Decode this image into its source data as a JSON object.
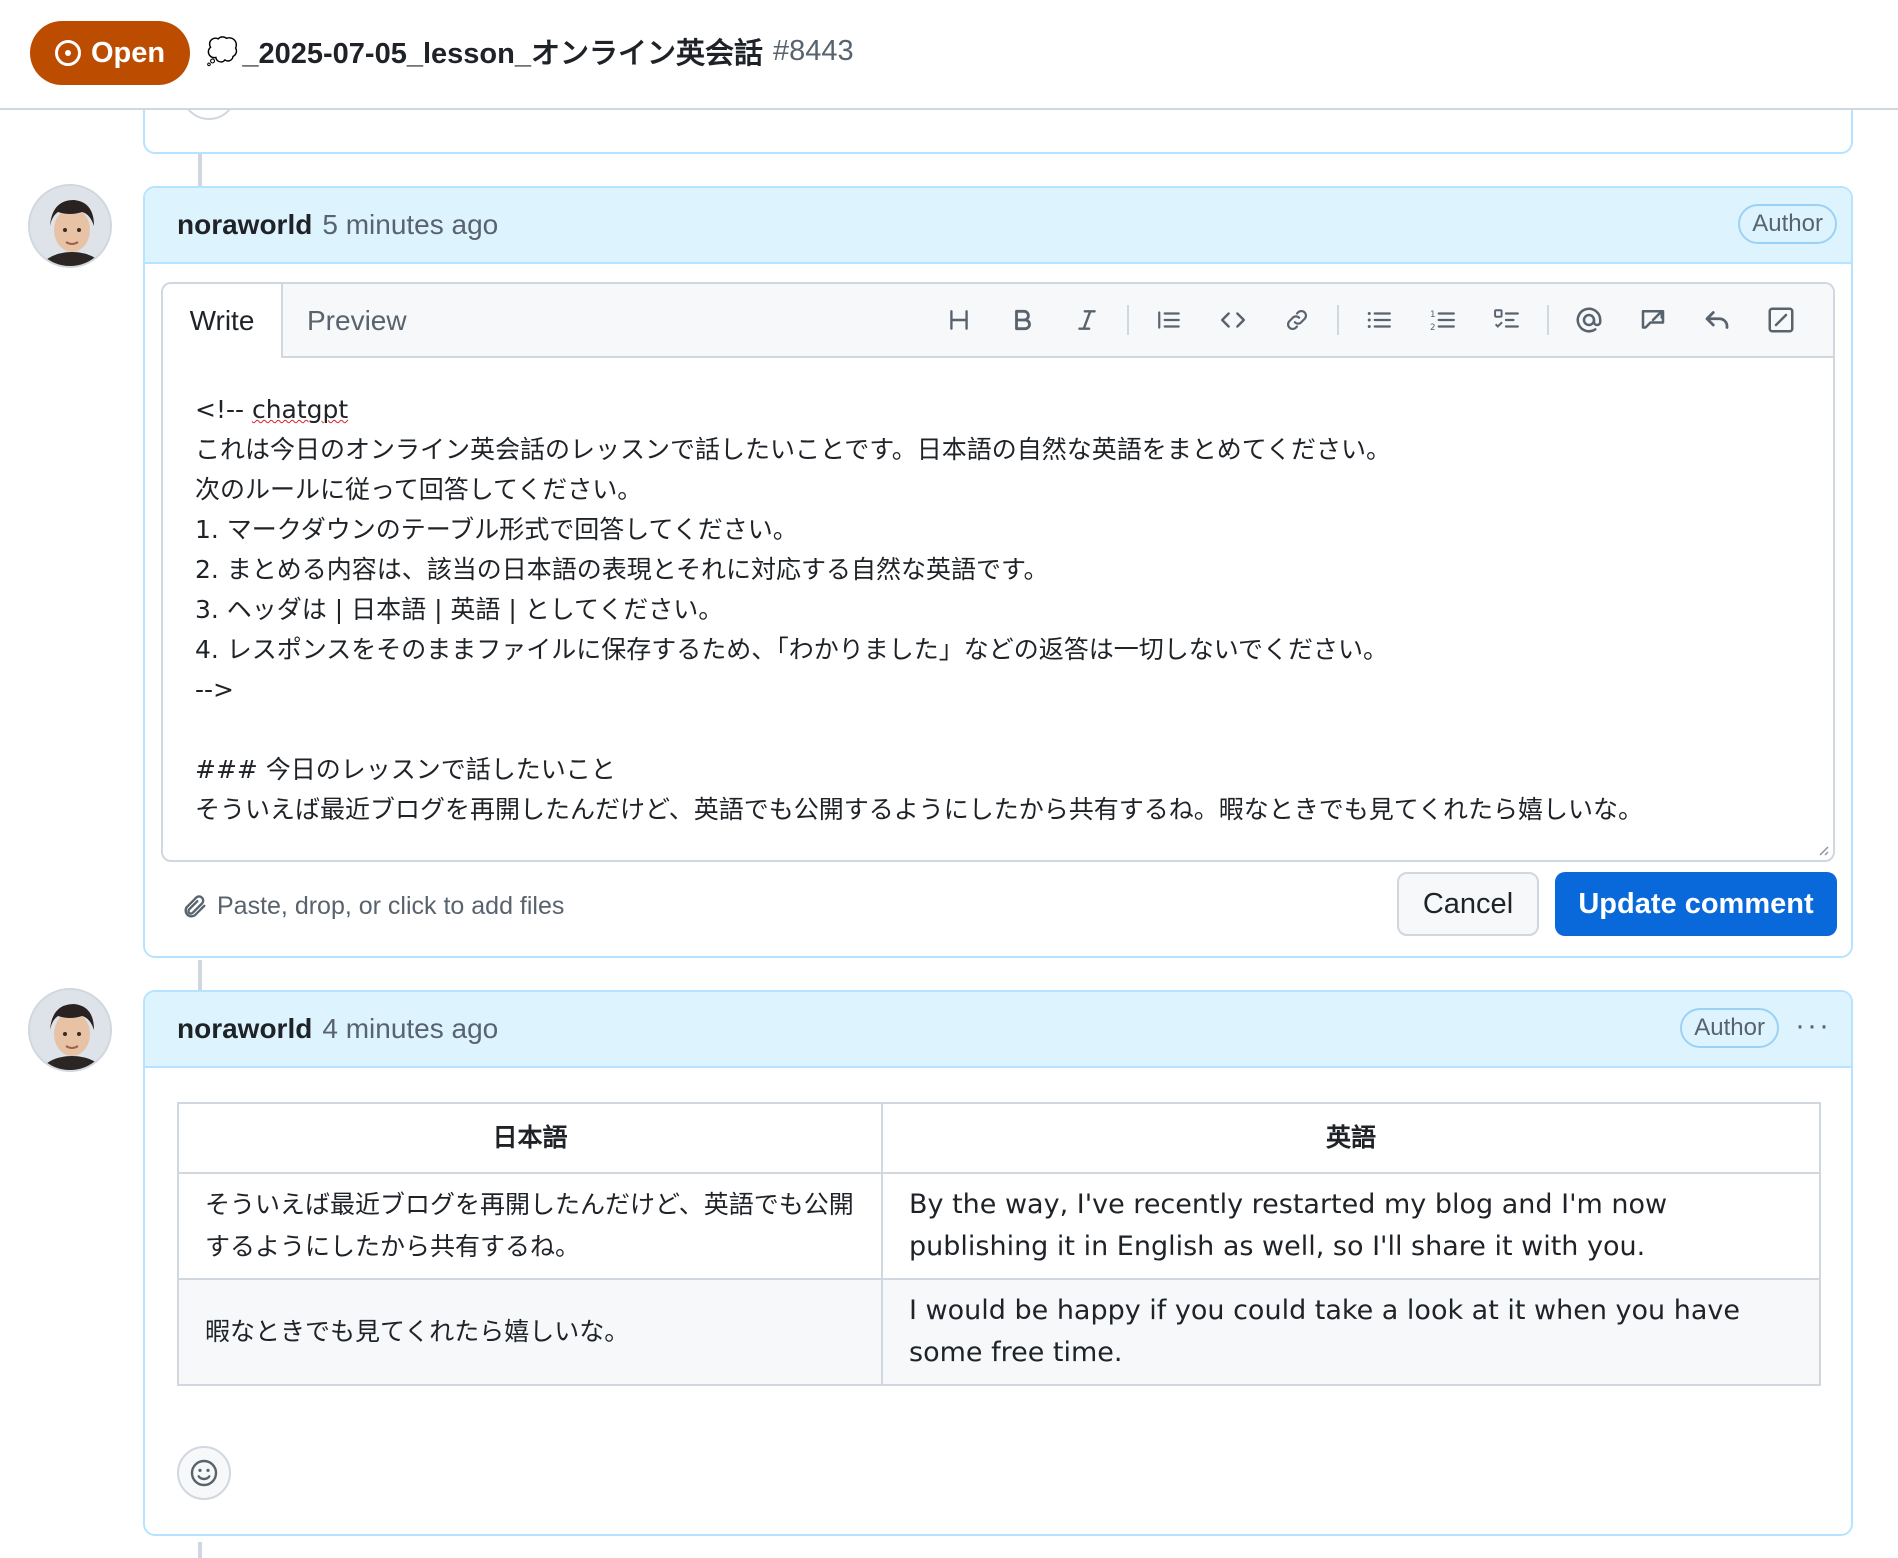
{
  "header": {
    "state_label": "Open",
    "title_icon": "speech-bubble-icon",
    "title": "_2025-07-05_lesson_オンライン英会話",
    "issue_number": "#8443"
  },
  "comment_edit": {
    "author": "noraworld",
    "time": "5 minutes ago",
    "badge": "Author",
    "tabs": {
      "write": "Write",
      "preview": "Preview"
    },
    "toolbar_icons": [
      "heading-icon",
      "bold-icon",
      "italic-icon",
      "quote-icon",
      "code-icon",
      "link-icon",
      "unordered-list-icon",
      "ordered-list-icon",
      "task-list-icon",
      "mention-icon",
      "reference-icon",
      "reply-icon",
      "fullscreen-icon"
    ],
    "body_lines": [
      "<!-- chatgpt",
      "これは今日のオンライン英会話のレッスンで話したいことです。日本語の自然な英語をまとめてください。",
      "次のルールに従って回答してください。",
      "1. マークダウンのテーブル形式で回答してください。",
      "2. まとめる内容は、該当の日本語の表現とそれに対応する自然な英語です。",
      "3. ヘッダは | 日本語 | 英語 | としてください。",
      "4. レスポンスをそのままファイルに保存するため、「わかりました」などの返答は一切しないでください。",
      "-->",
      "",
      "### 今日のレッスンで話したいこと",
      "そういえば最近ブログを再開したんだけど、英語でも公開するようにしたから共有するね。暇なときでも見てくれたら嬉しいな。"
    ],
    "attach_text": "Paste, drop, or click to add files",
    "cancel_label": "Cancel",
    "update_label": "Update comment"
  },
  "comment_table": {
    "author": "noraworld",
    "time": "4 minutes ago",
    "badge": "Author",
    "menu": "···",
    "headers": [
      "日本語",
      "英語"
    ],
    "rows": [
      {
        "ja": "そういえば最近ブログを再開したんだけど、英語でも公開するようにしたから共有するね。",
        "en": "By the way, I've recently restarted my blog and I'm now publishing it in English as well, so I'll share it with you."
      },
      {
        "ja": "暇なときでも見てくれたら嬉しいな。",
        "en": "I would be happy if you could take a look at it when you have some free time."
      }
    ]
  },
  "colors": {
    "open_badge": "#bc4c00",
    "comment_header_bg": "#ddf4ff",
    "comment_border": "#b6e3ff",
    "primary_button": "#0969da"
  }
}
